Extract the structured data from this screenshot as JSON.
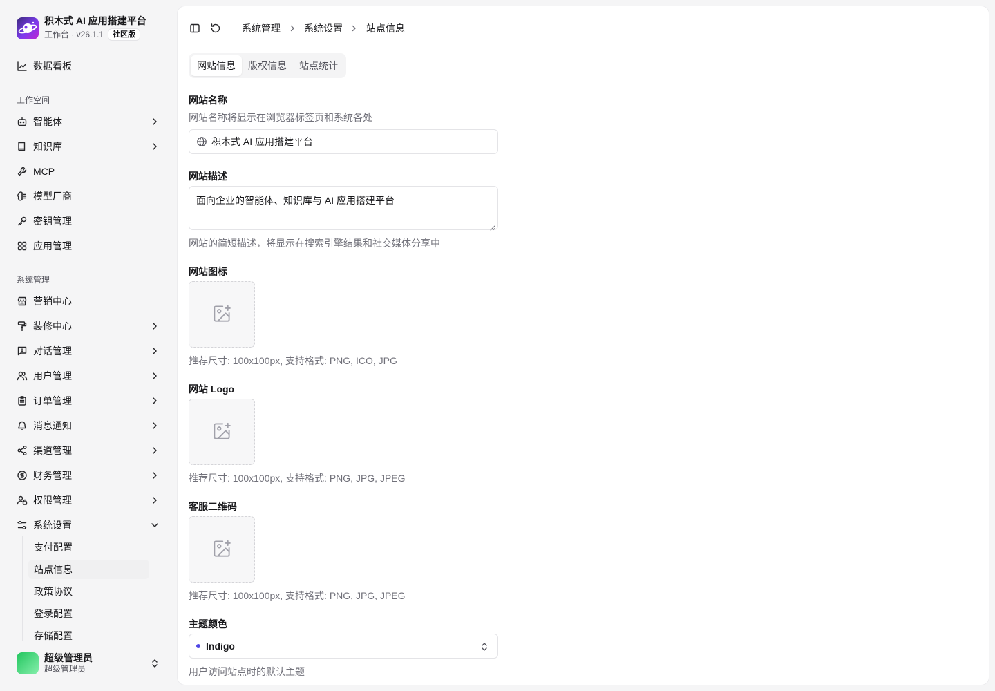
{
  "brand": {
    "title": "积木式 AI 应用搭建平台",
    "subtitle": "工作台 · v26.1.1",
    "edition": "社区版",
    "logo_icon": "planet-logo-icon"
  },
  "sidebar": {
    "dashboard": {
      "label": "数据看板",
      "icon": "chart-line-icon"
    },
    "workspace_title": "工作空间",
    "workspace_items": [
      {
        "label": "智能体",
        "icon": "bot-icon",
        "has_chevron": true
      },
      {
        "label": "知识库",
        "icon": "book-icon",
        "has_chevron": true
      },
      {
        "label": "MCP",
        "icon": "wrench-icon",
        "has_chevron": false
      },
      {
        "label": "模型厂商",
        "icon": "brain-icon",
        "has_chevron": false
      },
      {
        "label": "密钥管理",
        "icon": "key-icon",
        "has_chevron": false
      },
      {
        "label": "应用管理",
        "icon": "grid-icon",
        "has_chevron": false
      }
    ],
    "system_title": "系统管理",
    "system_items": [
      {
        "label": "营销中心",
        "icon": "store-icon",
        "has_chevron": false
      },
      {
        "label": "装修中心",
        "icon": "paint-roller-icon",
        "has_chevron": true
      },
      {
        "label": "对话管理",
        "icon": "message-alert-icon",
        "has_chevron": true
      },
      {
        "label": "用户管理",
        "icon": "users-icon",
        "has_chevron": true
      },
      {
        "label": "订单管理",
        "icon": "clipboard-icon",
        "has_chevron": true
      },
      {
        "label": "消息通知",
        "icon": "bell-icon",
        "has_chevron": true
      },
      {
        "label": "渠道管理",
        "icon": "share-icon",
        "has_chevron": true
      },
      {
        "label": "财务管理",
        "icon": "dollar-circle-icon",
        "has_chevron": true
      },
      {
        "label": "权限管理",
        "icon": "user-lock-icon",
        "has_chevron": true
      },
      {
        "label": "系统设置",
        "icon": "settings-sliders-icon",
        "has_chevron": true,
        "expanded": true
      }
    ],
    "settings_subitems": [
      {
        "label": "支付配置",
        "active": false
      },
      {
        "label": "站点信息",
        "active": true
      },
      {
        "label": "政策协议",
        "active": false
      },
      {
        "label": "登录配置",
        "active": false
      },
      {
        "label": "存储配置",
        "active": false
      }
    ]
  },
  "user": {
    "name": "超级管理员",
    "role": "超级管理员"
  },
  "topbar": {
    "breadcrumb": [
      "系统管理",
      "系统设置",
      "站点信息"
    ],
    "sidebar_toggle_icon": "sidebar-toggle-icon",
    "refresh_icon": "refresh-icon"
  },
  "tabs": [
    {
      "label": "网站信息",
      "active": true
    },
    {
      "label": "版权信息",
      "active": false
    },
    {
      "label": "站点统计",
      "active": false
    }
  ],
  "form": {
    "site_name": {
      "label": "网站名称",
      "help": "网站名称将显示在浏览器标签页和系统各处",
      "value": "积木式 AI 应用搭建平台",
      "icon": "globe-icon"
    },
    "site_desc": {
      "label": "网站描述",
      "value": "面向企业的智能体、知识库与 AI 应用搭建平台",
      "help": "网站的简短描述，将显示在搜索引擎结果和社交媒体分享中"
    },
    "site_icon": {
      "label": "网站图标",
      "help": "推荐尺寸: 100x100px, 支持格式: PNG, ICO, JPG"
    },
    "site_logo": {
      "label": "网站 Logo",
      "help": "推荐尺寸: 100x100px, 支持格式: PNG, JPG, JPEG"
    },
    "qr_code": {
      "label": "客服二维码",
      "help": "推荐尺寸: 100x100px, 支持格式: PNG, JPG, JPEG"
    },
    "theme": {
      "label": "主题颜色",
      "value": "Indigo",
      "color": "#4f46e5",
      "help": "用户访问站点时的默认主题"
    }
  },
  "colors": {
    "page_bg": "#f5f5f6",
    "panel_bg": "#ffffff",
    "text": "#18181b",
    "muted": "#71717a",
    "border": "#e4e4e7"
  }
}
